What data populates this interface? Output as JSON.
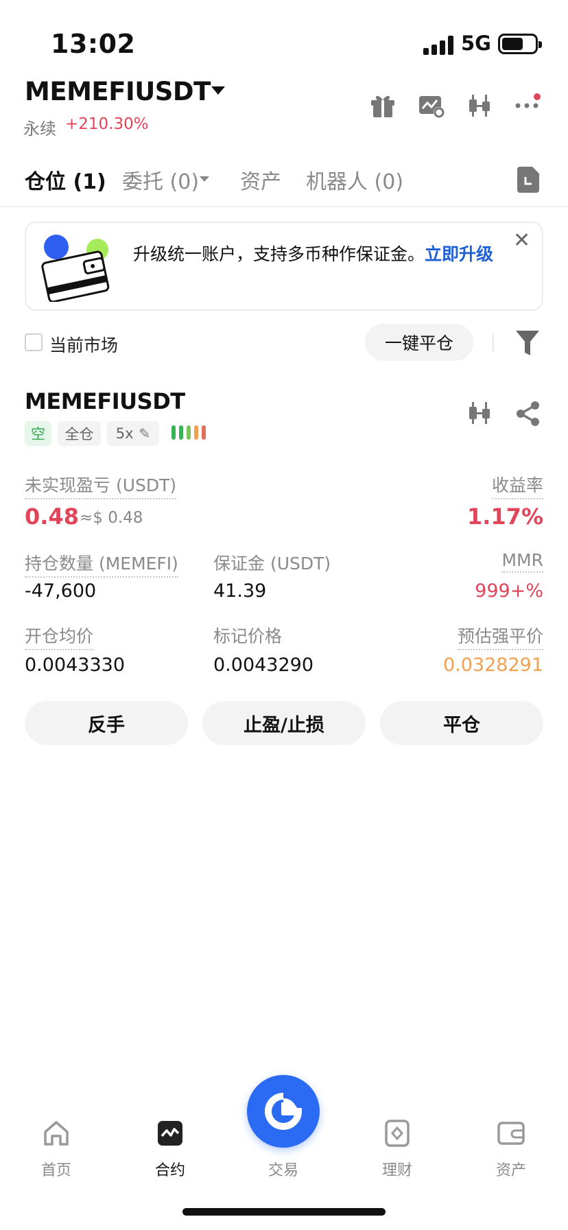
{
  "status_bar": {
    "time": "13:02",
    "network": "5G"
  },
  "header": {
    "pair": "MEMEFIUSDT",
    "contract_type": "永续",
    "change": "+210.30%",
    "icons": [
      "gift-icon",
      "chart-settings-icon",
      "candlestick-icon",
      "more-icon"
    ]
  },
  "tabs": [
    {
      "label": "仓位 (1)",
      "active": true
    },
    {
      "label": "委托 (0)",
      "active": false
    },
    {
      "label": "资产",
      "active": false
    },
    {
      "label": "机器人 (0)",
      "active": false
    }
  ],
  "banner": {
    "text": "升级统一账户，支持多币种作保证金。",
    "link": "立即升级"
  },
  "filter": {
    "current_market": "当前市场",
    "close_all": "一键平仓"
  },
  "position": {
    "symbol": "MEMEFIUSDT",
    "side": "空",
    "margin_mode": "全仓",
    "leverage": "5x",
    "risk_level": 5,
    "colors": {
      "loss": "#e0455a",
      "profit_short": "#2eaa50",
      "liq": "#f0a050"
    },
    "unrealized_pnl_label": "未实现盈亏 (USDT)",
    "unrealized_pnl": "0.48",
    "unrealized_pnl_usd": "≈$ 0.48",
    "roe_label": "收益率",
    "roe": "1.17%",
    "size_label": "持仓数量 (MEMEFI)",
    "size": "-47,600",
    "margin_label": "保证金 (USDT)",
    "margin": "41.39",
    "mmr_label": "MMR",
    "mmr": "999+%",
    "entry_label": "开仓均价",
    "entry": "0.0043330",
    "mark_label": "标记价格",
    "mark": "0.0043290",
    "liq_label": "预估强平价",
    "liq": "0.0328291"
  },
  "actions": {
    "reverse": "反手",
    "tp_sl": "止盈/止损",
    "close": "平仓"
  },
  "bottom_nav": [
    {
      "label": "首页",
      "icon": "home-icon",
      "active": false
    },
    {
      "label": "合约",
      "icon": "futures-icon",
      "active": true
    },
    {
      "label": "交易",
      "icon": "trade-icon",
      "active": false
    },
    {
      "label": "理财",
      "icon": "earn-icon",
      "active": false
    },
    {
      "label": "资产",
      "icon": "wallet-icon",
      "active": false
    }
  ]
}
